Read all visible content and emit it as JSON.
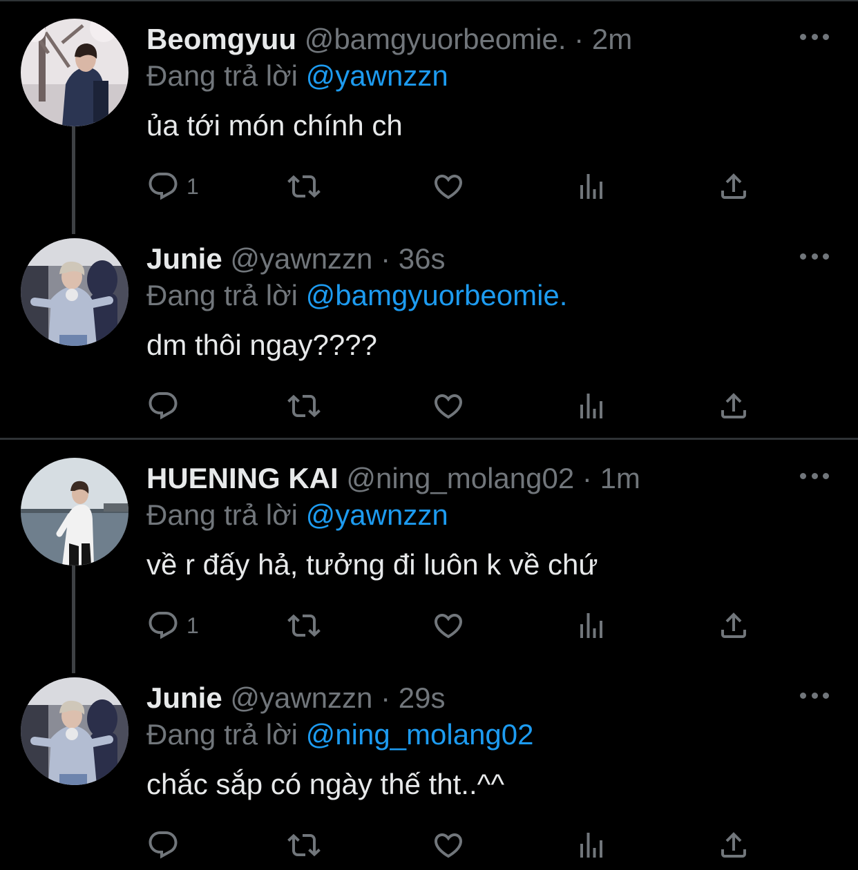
{
  "tweets": [
    {
      "display_name": "Beomgyuu",
      "handle": "@bamgyuorbeomie.",
      "separator": " · ",
      "time": "2m",
      "replying_prefix": "Đang trả lời ",
      "replying_to": "@yawnzzn",
      "text": "ủa tới món chính ch",
      "reply_count": "1"
    },
    {
      "display_name": "Junie",
      "handle": "@yawnzzn",
      "separator": " · ",
      "time": "36s",
      "replying_prefix": "Đang trả lời ",
      "replying_to": "@bamgyuorbeomie.",
      "text": "dm thôi ngay????",
      "reply_count": ""
    },
    {
      "display_name": "HUENING KAI",
      "handle": "@ning_molang02",
      "separator": " · ",
      "time": "1m",
      "replying_prefix": "Đang trả lời ",
      "replying_to": "@yawnzzn",
      "text": "về r đấy hả, tưởng đi luôn k về chứ",
      "reply_count": "1"
    },
    {
      "display_name": "Junie",
      "handle": "@yawnzzn",
      "separator": " · ",
      "time": "29s",
      "replying_prefix": "Đang trả lời ",
      "replying_to": "@ning_molang02",
      "text": "chắc sắp có ngày thế tht..^^",
      "reply_count": ""
    }
  ],
  "icons": {
    "reply": "reply-icon",
    "retweet": "retweet-icon",
    "like": "heart-icon",
    "views": "views-icon",
    "share": "share-icon",
    "more": "more-icon"
  },
  "colors": {
    "background": "#000000",
    "text_primary": "#e7e9ea",
    "text_secondary": "#71767b",
    "mention": "#1d9bf0",
    "divider": "#2f3336"
  }
}
